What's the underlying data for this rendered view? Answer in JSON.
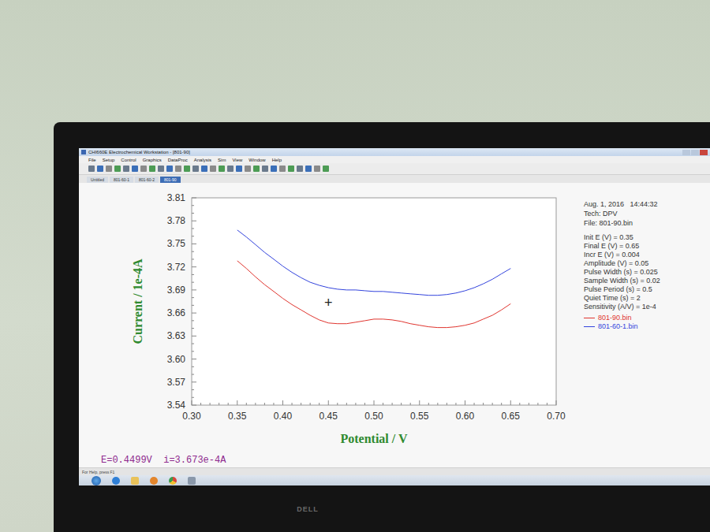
{
  "window": {
    "title": "CHI660E Electrochemical Workstation - [801-90]"
  },
  "menu": [
    "File",
    "Setup",
    "Control",
    "Graphics",
    "DataProc",
    "Analysis",
    "Sim",
    "View",
    "Window",
    "Help"
  ],
  "tabs": [
    {
      "label": "Untitled",
      "selected": false
    },
    {
      "label": "801-60-1",
      "selected": false
    },
    {
      "label": "801-60-2",
      "selected": false
    },
    {
      "label": "801-90",
      "selected": true
    }
  ],
  "chart": {
    "x_axis": {
      "title": "Potential / V",
      "min": 0.3,
      "max": 0.7,
      "ticks": [
        "0.30",
        "0.35",
        "0.40",
        "0.45",
        "0.50",
        "0.55",
        "0.60",
        "0.65",
        "0.70"
      ]
    },
    "y_axis": {
      "title": "Current / 1e-4A",
      "min": 3.54,
      "max": 3.81,
      "ticks": [
        "3.81",
        "3.78",
        "3.75",
        "3.72",
        "3.69",
        "3.66",
        "3.63",
        "3.60",
        "3.57",
        "3.54"
      ]
    },
    "series": [
      {
        "name": "801-90.bin",
        "color": "#e0352f",
        "potential": [
          0.35,
          0.36,
          0.37,
          0.38,
          0.39,
          0.4,
          0.41,
          0.42,
          0.43,
          0.44,
          0.45,
          0.46,
          0.47,
          0.48,
          0.49,
          0.5,
          0.51,
          0.52,
          0.53,
          0.54,
          0.55,
          0.56,
          0.57,
          0.58,
          0.59,
          0.6,
          0.61,
          0.62,
          0.63,
          0.64,
          0.65
        ],
        "current": [
          3.728,
          3.718,
          3.707,
          3.697,
          3.688,
          3.679,
          3.671,
          3.664,
          3.657,
          3.651,
          3.647,
          3.646,
          3.646,
          3.648,
          3.65,
          3.652,
          3.652,
          3.651,
          3.649,
          3.646,
          3.644,
          3.642,
          3.641,
          3.641,
          3.642,
          3.644,
          3.647,
          3.652,
          3.657,
          3.664,
          3.672
        ]
      },
      {
        "name": "801-60-1.bin",
        "color": "#3344dd",
        "potential": [
          0.35,
          0.36,
          0.37,
          0.38,
          0.39,
          0.4,
          0.41,
          0.42,
          0.43,
          0.44,
          0.45,
          0.46,
          0.47,
          0.48,
          0.49,
          0.5,
          0.51,
          0.52,
          0.53,
          0.54,
          0.55,
          0.56,
          0.57,
          0.58,
          0.59,
          0.6,
          0.61,
          0.62,
          0.63,
          0.64,
          0.65
        ],
        "current": [
          3.768,
          3.759,
          3.749,
          3.739,
          3.73,
          3.721,
          3.713,
          3.706,
          3.7,
          3.696,
          3.693,
          3.691,
          3.69,
          3.69,
          3.689,
          3.688,
          3.688,
          3.687,
          3.686,
          3.685,
          3.684,
          3.683,
          3.683,
          3.684,
          3.686,
          3.689,
          3.693,
          3.698,
          3.704,
          3.711,
          3.718
        ]
      }
    ],
    "cursor": {
      "potential": 0.45,
      "current": 3.673,
      "symbol": "+"
    }
  },
  "info": {
    "date": "Aug. 1, 2016   14:44:32",
    "lines": [
      "Tech: DPV",
      "File: 801-90.bin"
    ],
    "params": [
      "Init E (V) = 0.35",
      "Final E (V) = 0.65",
      "Incr E (V) = 0.004",
      "Amplitude (V) = 0.05",
      "Pulse Width (s) = 0.025",
      "Sample Width (s) = 0.02",
      "Pulse Period (s) = 0.5",
      "Quiet Time (s) = 2",
      "Sensitivity (A/V) = 1e-4"
    ]
  },
  "readout": "E=0.4499V  i=3.673e-4A",
  "status_bar": "For Help, press F1",
  "monitor": {
    "brand": "DELL"
  }
}
